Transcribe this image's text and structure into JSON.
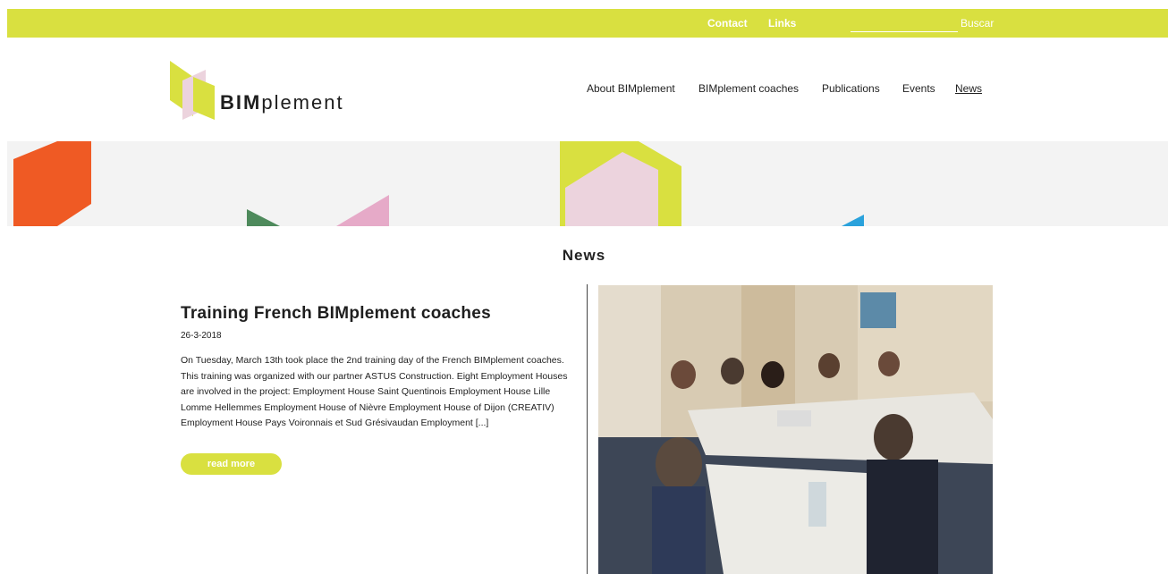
{
  "topbar": {
    "contact": "Contact",
    "links": "Links",
    "search_button": "Buscar",
    "search_value": ""
  },
  "logo": {
    "bold": "BIM",
    "rest": "plement"
  },
  "nav": {
    "items": [
      "About BIMplement",
      "BIMplement coaches",
      "Publications",
      "Events",
      "News"
    ],
    "active": "News"
  },
  "section_title": "News",
  "article": {
    "title": "Training French BIMplement coaches",
    "date": "26-3-2018",
    "body": "On Tuesday, March 13th took place the 2nd training day of the French BIMplement coaches. This training was organized with our partner ASTUS Construction. Eight Employment Houses are involved in the project: Employment House Saint Quentinois Employment House Lille Lomme Hellemmes Employment House of Nièvre Employment House of Dijon (CREATIV) Employment House Pays Voironnais et Sud Grésivaudan Employment [...]",
    "read_more": "read more"
  },
  "colors": {
    "accent": "#d9e040",
    "banner_bg": "#f3f3f3",
    "orange": "#ef5a24",
    "pink": "#e6aac8",
    "green": "#4e8a5c",
    "blue": "#2aa2dc"
  }
}
